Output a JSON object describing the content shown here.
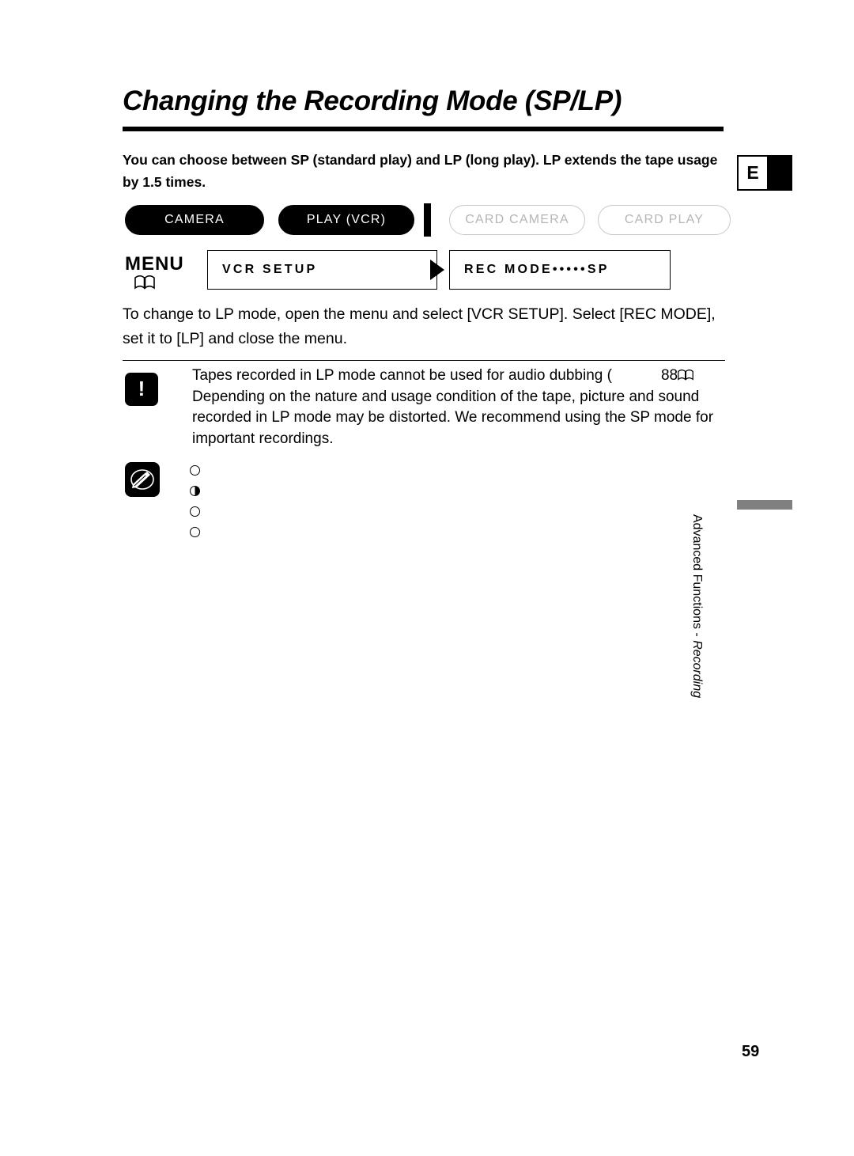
{
  "document": {
    "title": "Changing the Recording Mode (SP/LP)",
    "intro": "You can choose between SP (standard play) and LP (long play). LP extends the tape usage by 1.5 times.",
    "body_paragraph": "To change to LP mode, open the menu and select [VCR SETUP]. Select [REC MODE], set it to [LP] and close the menu.",
    "caution_text_1": "Tapes recorded in LP mode cannot be used for audio dubbing (",
    "caution_ref_page": "88",
    "caution_text_2": "Depending on the nature and usage condition of the tape, picture and sound recorded in LP mode may be distorted. We recommend using the SP mode for important recordings.",
    "page_number": "59",
    "edition_letter": "E",
    "side_tab_line1": "Advanced Functions -",
    "side_tab_line2": "Recording"
  },
  "modes": [
    {
      "label": "CAMERA",
      "state": "on"
    },
    {
      "label": "PLAY (VCR)",
      "state": "on"
    },
    {
      "label": "CARD CAMERA",
      "state": "off"
    },
    {
      "label": "CARD PLAY",
      "state": "off"
    }
  ],
  "menu": {
    "label": "MENU",
    "item_1": "VCR  SETUP",
    "item_2": "REC  MODE•••••SP"
  },
  "bullets": [
    {
      "style": "open"
    },
    {
      "style": "half"
    },
    {
      "style": "open"
    },
    {
      "style": "open"
    }
  ]
}
